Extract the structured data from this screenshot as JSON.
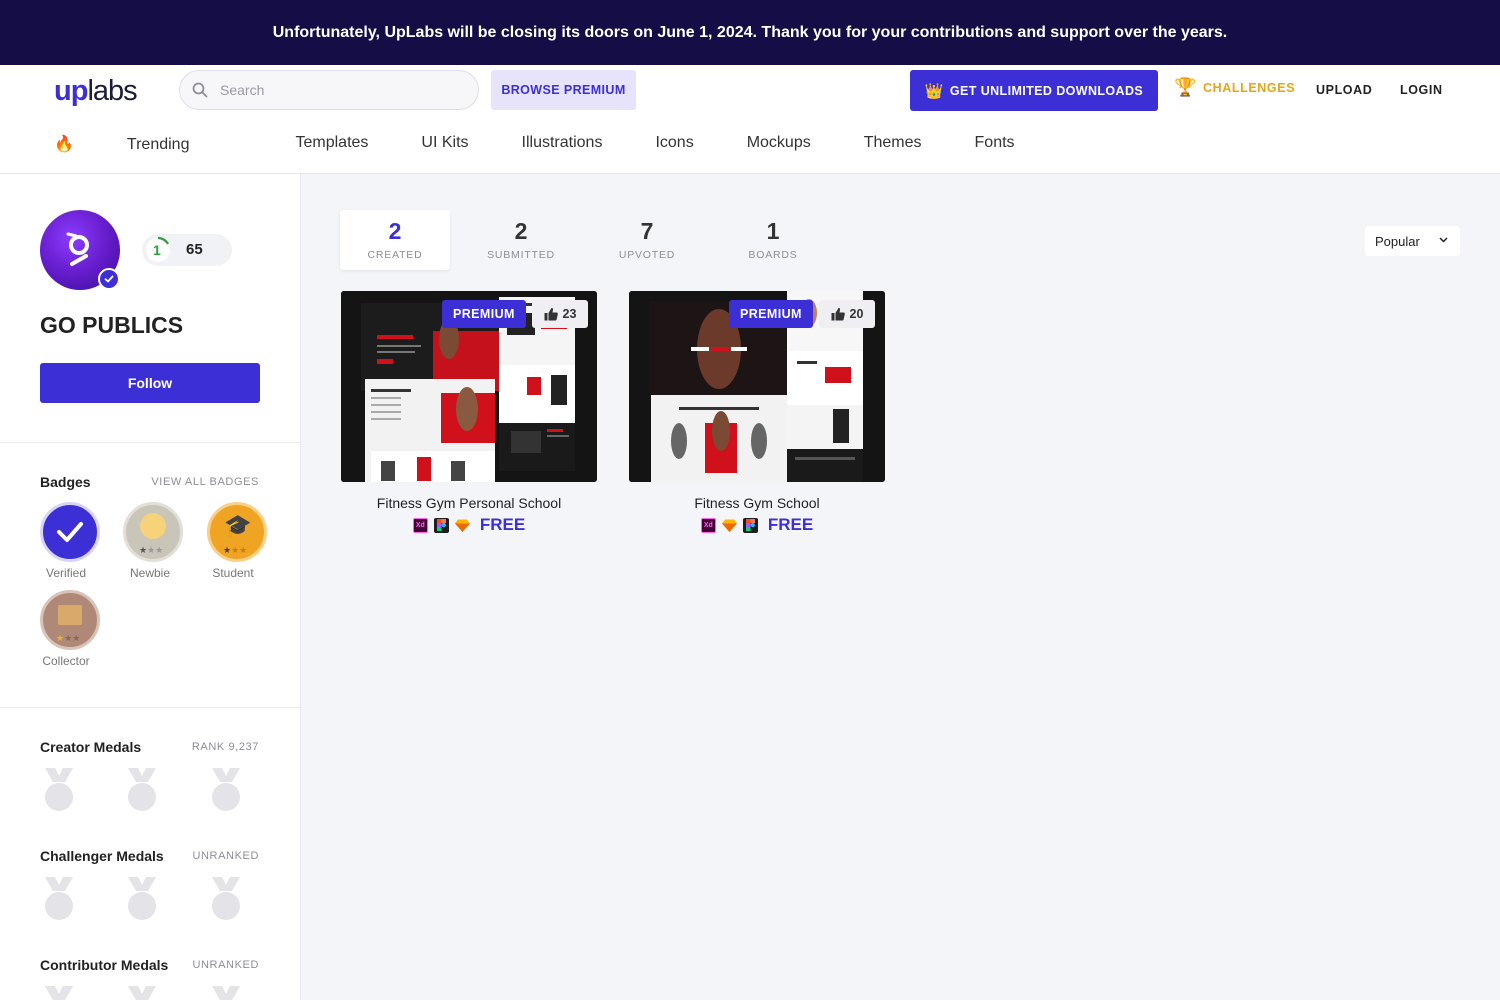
{
  "banner": {
    "text": "Unfortunately, UpLabs will be closing its doors on June 1, 2024. Thank you for your contributions and support over the years."
  },
  "header": {
    "logo_up": "up",
    "logo_labs": "labs",
    "search_placeholder": "Search",
    "browse_premium": "BROWSE PREMIUM",
    "get_unlimited": "GET UNLIMITED DOWNLOADS",
    "challenges": "CHALLENGES",
    "upload": "UPLOAD",
    "login": "LOGIN"
  },
  "categories": [
    "Trending",
    "Templates",
    "UI Kits",
    "Illustrations",
    "Icons",
    "Mockups",
    "Themes",
    "Fonts"
  ],
  "profile": {
    "name": "GO PUBLICS",
    "level": "1",
    "points": "65",
    "follow": "Follow"
  },
  "badges": {
    "title": "Badges",
    "view_all": "VIEW ALL BADGES",
    "items": [
      {
        "label": "Verified",
        "stars_filled": 0
      },
      {
        "label": "Newbie",
        "stars_filled": 1
      },
      {
        "label": "Student",
        "stars_filled": 1
      },
      {
        "label": "Collector",
        "stars_filled": 1
      }
    ]
  },
  "medals": [
    {
      "title": "Creator Medals",
      "rank": "RANK 9,237"
    },
    {
      "title": "Challenger Medals",
      "rank": "UNRANKED"
    },
    {
      "title": "Contributor Medals",
      "rank": "UNRANKED"
    }
  ],
  "tabs": [
    {
      "count": "2",
      "label": "CREATED",
      "active": true
    },
    {
      "count": "2",
      "label": "SUBMITTED",
      "active": false
    },
    {
      "count": "7",
      "label": "UPVOTED",
      "active": false
    },
    {
      "count": "1",
      "label": "BOARDS",
      "active": false
    }
  ],
  "sort": {
    "selected": "Popular"
  },
  "cards": [
    {
      "title": "Fitness Gym Personal School",
      "premium": "PREMIUM",
      "likes": "23",
      "price": "FREE",
      "tools": [
        "xd",
        "figma",
        "sketch"
      ]
    },
    {
      "title": "Fitness Gym School",
      "premium": "PREMIUM",
      "likes": "20",
      "price": "FREE",
      "tools": [
        "xd",
        "sketch",
        "figma"
      ]
    }
  ],
  "colors": {
    "accent": "#3d2fd6",
    "banner": "#150d45",
    "gold": "#e8a317"
  }
}
